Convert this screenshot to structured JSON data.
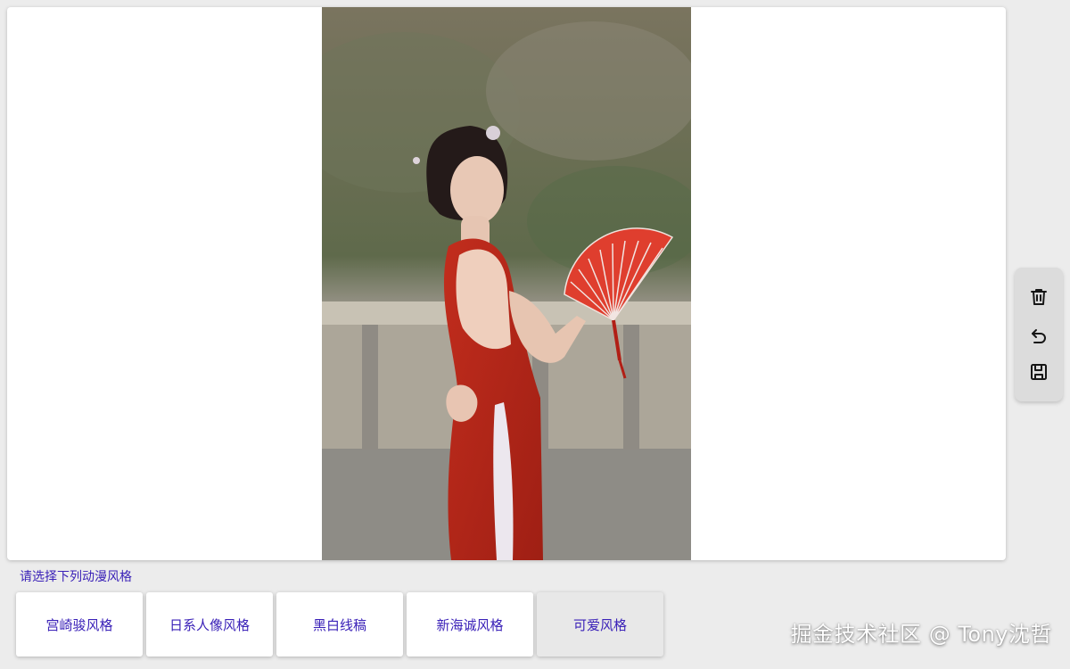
{
  "canvas": {
    "image_alt": "portrait photo of a woman in a red dress holding a red fan"
  },
  "toolbar": {
    "icons": [
      "trash-icon",
      "undo-icon",
      "save-icon"
    ]
  },
  "styles": {
    "prompt": "请选择下列动漫风格",
    "options": [
      "宫崎骏风格",
      "日系人像风格",
      "黑白线稿",
      "新海诚风格",
      "可爱风格"
    ],
    "selected_index": 4
  },
  "watermark": {
    "text": "掘金技术社区 @ Tony沈哲"
  },
  "colors": {
    "accent": "#3b22b8",
    "page_background": "#ececec",
    "selected_option": "#e8e8e8"
  }
}
